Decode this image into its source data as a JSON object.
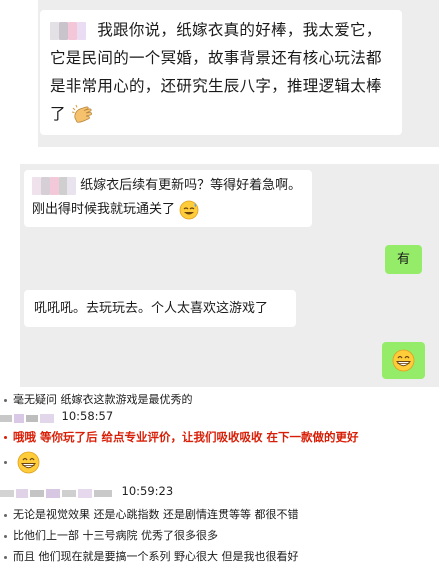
{
  "chat_screenshot": {
    "messages": [
      {
        "text": "我跟你说，纸嫁衣真的好棒，我太爱它，它是民间的一个冥婚，故事背景还有核心玩法都是非常用心的，还研究生辰八字，推理逻辑太棒了",
        "trailing_emoji": "clapping-hands"
      },
      {
        "text": "纸嫁衣后续有更新吗？等得好着急啊。刚出得时候我就玩通关了",
        "trailing_emoji": "sweat-smile"
      },
      {
        "text": "有",
        "is_self": true
      },
      {
        "text": "吼吼吼。去玩玩去。个人太喜欢这游戏了"
      },
      {
        "emoji": "grinning-face",
        "is_self": true
      }
    ]
  },
  "group_log": {
    "line1": "毫无疑问  纸嫁衣这款游戏是最优秀的",
    "time1": "10:58:57",
    "line2": "哦哦  等你玩了后 给点专业评价，让我们吸收吸收  在下一款做的更好",
    "time2": "10:59:23",
    "line3": "无论是视觉效果  还是心跳指数    还是剧情连贯等等    都很不错",
    "line4": "比他们上一部  十三号病院  优秀了很多很多",
    "line5": "而且  他们现在就是要搞一个系列   野心很大   但是我也很看好"
  },
  "colors": {
    "highlight_red": "#d81e06",
    "self_bubble": "#95ec69",
    "chat_bg": "#ededed"
  }
}
